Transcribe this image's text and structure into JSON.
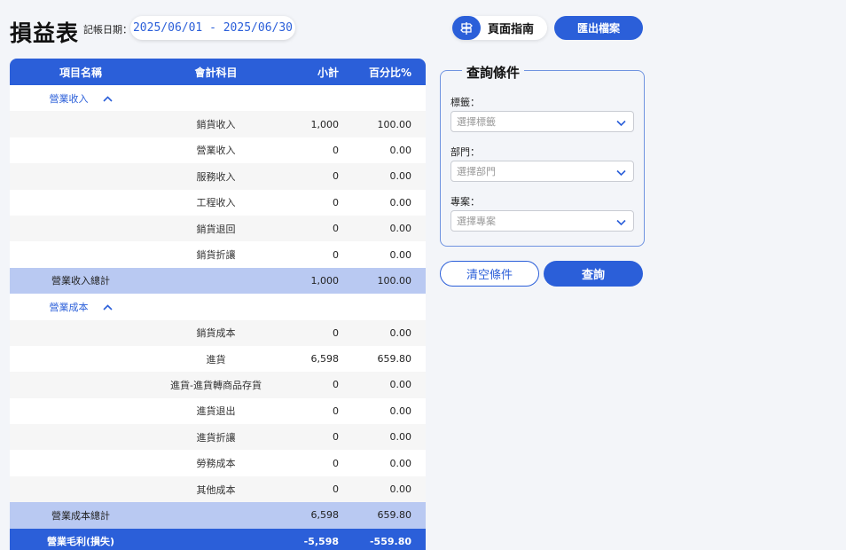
{
  "header": {
    "title": "損益表",
    "date_label": "記帳日期：",
    "date_range": "2025/06/01 - 2025/06/30",
    "guide_label": "頁面指南",
    "export_label": "匯出檔案"
  },
  "table": {
    "columns": [
      "項目名稱",
      "會計科目",
      "小計",
      "百分比%"
    ],
    "revenue_group": "營業收入",
    "revenue_rows": [
      {
        "account": "銷貨收入",
        "subtotal": "1,000",
        "percent": "100.00"
      },
      {
        "account": "營業收入",
        "subtotal": "0",
        "percent": "0.00"
      },
      {
        "account": "服務收入",
        "subtotal": "0",
        "percent": "0.00"
      },
      {
        "account": "工程收入",
        "subtotal": "0",
        "percent": "0.00"
      },
      {
        "account": "銷貨退回",
        "subtotal": "0",
        "percent": "0.00"
      },
      {
        "account": "銷貨折讓",
        "subtotal": "0",
        "percent": "0.00"
      }
    ],
    "revenue_total": {
      "name": "營業收入總計",
      "subtotal": "1,000",
      "percent": "100.00"
    },
    "cost_group": "營業成本",
    "cost_rows": [
      {
        "account": "銷貨成本",
        "subtotal": "0",
        "percent": "0.00"
      },
      {
        "account": "進貨",
        "subtotal": "6,598",
        "percent": "659.80"
      },
      {
        "account": "進貨-進貨轉商品存貨",
        "subtotal": "0",
        "percent": "0.00"
      },
      {
        "account": "進貨退出",
        "subtotal": "0",
        "percent": "0.00"
      },
      {
        "account": "進貨折讓",
        "subtotal": "0",
        "percent": "0.00"
      },
      {
        "account": "勞務成本",
        "subtotal": "0",
        "percent": "0.00"
      },
      {
        "account": "其他成本",
        "subtotal": "0",
        "percent": "0.00"
      }
    ],
    "cost_total": {
      "name": "營業成本總計",
      "subtotal": "6,598",
      "percent": "659.80"
    },
    "gross_profit": {
      "name": "營業毛利(損失)",
      "subtotal": "-5,598",
      "percent": "-559.80"
    }
  },
  "filters": {
    "legend": "查詢條件",
    "tag_label": "標籤：",
    "tag_placeholder": "選擇標籤",
    "dept_label": "部門：",
    "dept_placeholder": "選擇部門",
    "project_label": "專案：",
    "project_placeholder": "選擇專案",
    "clear_label": "清空條件",
    "query_label": "查詢"
  },
  "colors": {
    "accent": "#2b5fd9",
    "total_row": "#b9c9f2"
  },
  "icons": {
    "guide": "guide-signpost-icon",
    "collapse": "chevron-up-icon",
    "dropdown": "chevron-down-icon"
  }
}
